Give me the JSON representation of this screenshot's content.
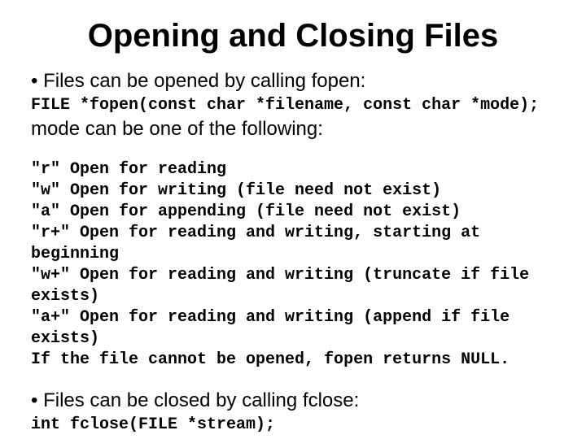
{
  "title": "Opening and Closing Files",
  "bullet1": "• Files can be opened by calling fopen:",
  "fopen_sig": "FILE *fopen(const char *filename, const char *mode);",
  "mode_intro": "mode can be one of the following:",
  "modes_block": "\"r\" Open for reading\n\"w\" Open for writing (file need not exist)\n\"a\" Open for appending (file need not exist)\n\"r+\" Open for reading and writing, starting at beginning\n\"w+\" Open for reading and writing (truncate if file exists)\n\"a+\" Open for reading and writing (append if file exists)\nIf the file cannot be opened, fopen returns NULL.",
  "bullet2": "• Files can be closed by calling fclose:",
  "fclose_sig": "int fclose(FILE *stream);"
}
